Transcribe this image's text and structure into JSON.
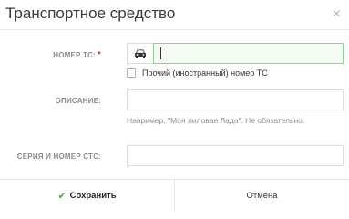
{
  "dialog": {
    "title": "Транспортное средство",
    "close_glyph": "×"
  },
  "form": {
    "plate": {
      "label": "НОМЕР ТС:",
      "required_mark": "*",
      "icon": "car-icon",
      "value": ""
    },
    "foreign_plate": {
      "label": "Прочий (иностранный) номер ТС",
      "checked": false
    },
    "description": {
      "label": "ОПИСАНИЕ:",
      "value": "",
      "hint": "Например, \"Моя лиловая Лада\". Не обязательно."
    },
    "sts": {
      "label": "СЕРИЯ И НОМЕР СТС:",
      "value": ""
    }
  },
  "footer": {
    "save_label": "Сохранить",
    "save_icon": "check-icon",
    "cancel_label": "Отмена"
  },
  "colors": {
    "accent_green": "#4caf50",
    "active_input_border": "#8ed28e",
    "required_red": "#e4322b"
  }
}
